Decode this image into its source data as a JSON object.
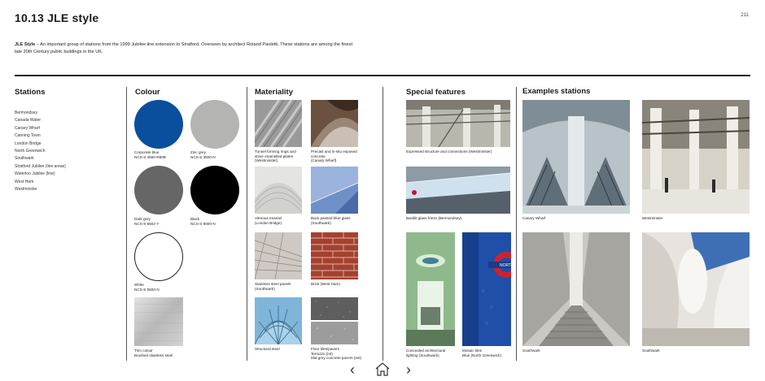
{
  "header": {
    "title": "10.13  JLE style",
    "page_number": "211",
    "intro_bold": "JLE Style",
    "intro_text": "  –  An important group of stations from the 1999 Jubilee line extension to Stratford. Overseen by architect Roland Paoletti. These stations are among the finest late 20th Century public buildings in the UK."
  },
  "sections": {
    "stations": "Stations",
    "colour": "Colour",
    "materiality": "Materiality",
    "special": "Special features",
    "examples": "Examples stations"
  },
  "stations": [
    "Bermondsey",
    "Canada Water",
    "Canary Wharf",
    "Canning Town",
    "London Bridge",
    "North Greenwich",
    "Southwark",
    "Stratford Jubilee (line areas)",
    "Waterloo Jubilee (line)",
    "West Ham",
    "Westminster"
  ],
  "colours": [
    {
      "line1": "Corporate blue",
      "line2": "NCS-S 4550-R80B",
      "hex": "#0a4f9e"
    },
    {
      "line1": "Zinc grey",
      "line2": "NCS-S 3500-N",
      "hex": "#b4b5b2"
    },
    {
      "line1": "Dark grey",
      "line2": "NCS-S 6502-Y",
      "hex": "#666666"
    },
    {
      "line1": "Black",
      "line2": "NCS-S 9000-N",
      "hex": "#000000"
    },
    {
      "line1": "White",
      "line2": "NCS-S 0500-N",
      "hex": "#ffffff"
    },
    {
      "line1": "Trim colour",
      "line2": "Brushed stainless steel",
      "hex": "#c8c8c8"
    }
  ],
  "materiality": [
    {
      "line1": "Tunnel forming rings and",
      "line2": "stove enamelled plates",
      "line3": "(Westminster)"
    },
    {
      "line1": "Precast and in-situ exposed",
      "line2": "concrete",
      "line3": "(Canary Wharf)"
    },
    {
      "line1": "Vitreous enamel",
      "line2": "(London Bridge)",
      "line3": ""
    },
    {
      "line1": "Back painted blue glass",
      "line2": "(Southwark)",
      "line3": ""
    },
    {
      "line1": "Stainless steel panels",
      "line2": "(Southwark)",
      "line3": ""
    },
    {
      "line1": "Brick (West Ham)",
      "line2": "",
      "line3": ""
    },
    {
      "line1": "Structural steel",
      "line2": "",
      "line3": ""
    },
    {
      "line1": "Floor tiles/pavers",
      "line2": "Terrazzo (int)",
      "line3": "Mid grey concrete pavers (ext)"
    }
  ],
  "special": [
    {
      "line1": "Expressed structure and connections (Westminster)",
      "line2": ""
    },
    {
      "line1": "Backlit glass frieze (Bermondsey)",
      "line2": ""
    },
    {
      "line1": "Concealed architectural",
      "line2": "lighting (Southwark)"
    },
    {
      "line1": "Mosaic tiles",
      "line2": "Blue (North Greenwich)"
    }
  ],
  "examples": [
    "Canary Wharf",
    "Westminster",
    "Southwark",
    "Southwark"
  ],
  "nav": {
    "prev": "‹",
    "next": "›",
    "home_icon": "home-icon"
  }
}
